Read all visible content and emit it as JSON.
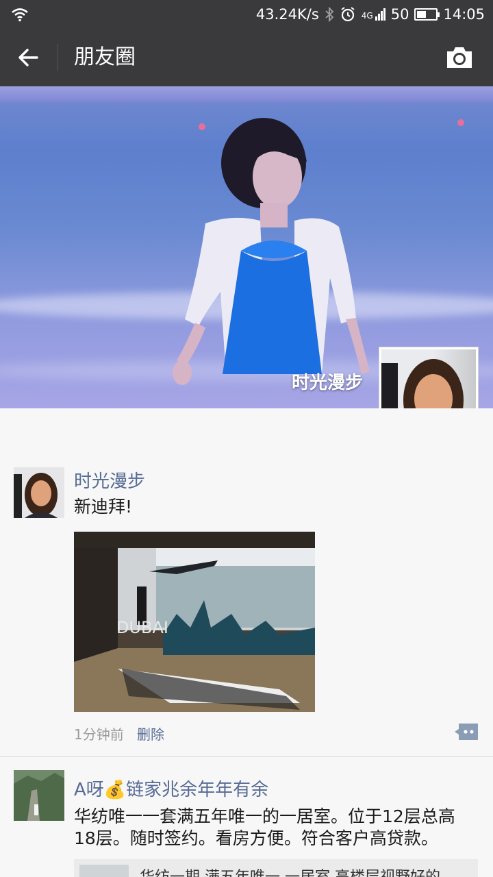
{
  "status_bar": {
    "net_speed": "43.24K/s",
    "network": "4G",
    "battery": "50",
    "battery_level_percent": 50,
    "time": "14:05"
  },
  "header": {
    "title": "朋友圈",
    "back_icon": "arrow-left-icon",
    "camera_icon": "camera-icon"
  },
  "cover": {
    "user_name": "时光漫步"
  },
  "posts": [
    {
      "nickname": "时光漫步",
      "text": "新迪拜!",
      "photo_text": "DUBAI",
      "time": "1分钟前",
      "delete_label": "删除"
    },
    {
      "nickname": "A呀💰链家兆余年年有余",
      "text_line1": "华纺唯一一套满五年唯一的一居室。位于12层总高",
      "text_line2": "18层。随时签约。看房方便。符合客户高贷款。",
      "link_text": "华纺一期 满五年唯一 一居室 高楼层视野好的"
    }
  ],
  "colors": {
    "bar_bg": "#3a3a3c",
    "nickname": "#576b95",
    "feed_bg": "#f7f7f7"
  }
}
